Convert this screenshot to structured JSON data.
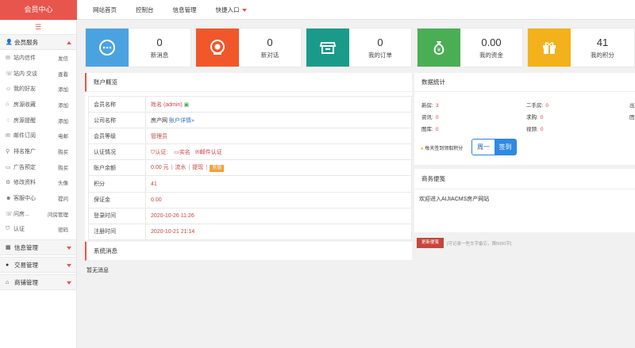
{
  "brand": "会员中心",
  "topnav": [
    "网站首页",
    "控制台",
    "信息管理",
    "快捷入口"
  ],
  "sidebar": {
    "toggle": "☰",
    "group1": "会员服务",
    "items": [
      {
        "label": "站内信件",
        "action": "发信"
      },
      {
        "label": "站内 交谈",
        "action": "查看"
      },
      {
        "label": "我的好友",
        "action": "添加"
      },
      {
        "label": "房源收藏",
        "action": "添加"
      },
      {
        "label": "房源提醒",
        "action": "添加"
      },
      {
        "label": "邮件订阅",
        "action": "电邮"
      },
      {
        "label": "排名推广",
        "action": "购买"
      },
      {
        "label": "广告预定",
        "action": "购买"
      },
      {
        "label": "修改资料",
        "action": "头像"
      },
      {
        "label": "客服中心",
        "action": "提问"
      },
      {
        "label": "问房...",
        "action": "问房管理"
      },
      {
        "label": "认证",
        "action": "密码"
      }
    ],
    "groups": [
      "信息管理",
      "交易管理",
      "商铺管理"
    ]
  },
  "cards": [
    {
      "num": "0",
      "label": "新消息",
      "color": "#4aa3e0"
    },
    {
      "num": "0",
      "label": "新对话",
      "color": "#f0572a"
    },
    {
      "num": "0",
      "label": "我的订单",
      "color": "#1a9b8a"
    },
    {
      "num": "0.00",
      "label": "我的资金",
      "color": "#4aae55"
    },
    {
      "num": "41",
      "label": "我的积分",
      "color": "#f3b21b"
    }
  ],
  "account": {
    "title": "账户概览",
    "rows": {
      "name_k": "会员名称",
      "name_v": "姓名 (admin)",
      "company_k": "公司名称",
      "company_v": "房产网",
      "company_link": "账户详情»",
      "level_k": "会员等级",
      "level_v": "管理员",
      "cert_k": "认证情况",
      "cert_1": "认证:",
      "cert_2": "实名",
      "cert_3": "邮件认证",
      "balance_k": "账户余额",
      "balance_v": "0.00 元",
      "balance_a1": "流水",
      "balance_a2": "提现",
      "balance_tag": "充值",
      "points_k": "积分",
      "points_v": "41",
      "deposit_k": "保证金",
      "deposit_v": "0.00",
      "login_k": "登录时间",
      "login_v": "2020-10-26 11:26",
      "reg_k": "注册时间",
      "reg_v": "2020-10-21 21:14"
    }
  },
  "system": {
    "title": "系统消息",
    "empty": "暂无消息"
  },
  "stats": {
    "title": "数据统计",
    "left": [
      {
        "k": "新房:",
        "v": "3"
      },
      {
        "k": "资讯:",
        "v": "0"
      },
      {
        "k": "图库:",
        "v": "0"
      }
    ],
    "right": [
      {
        "k": "二手房:",
        "v": "0"
      },
      {
        "k": "求购:",
        "v": "0"
      },
      {
        "k": "视频:",
        "v": "0"
      }
    ],
    "edge": [
      "出",
      "团"
    ],
    "signin_note": "每天签到领取积分",
    "signin_day": "周一",
    "signin_btn": "签到"
  },
  "memo": {
    "title": "商务便笺",
    "text": "欢迎进入AIJIACMS房产网站",
    "button": "更新便笺",
    "hint": "[可记录一些文字备忘，限5000字]"
  }
}
